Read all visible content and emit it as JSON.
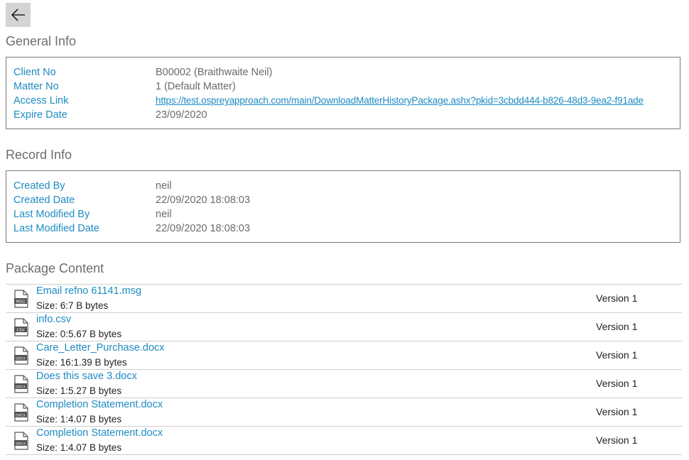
{
  "general_info": {
    "title": "General Info",
    "fields": [
      {
        "label": "Client No",
        "value": "B00002 (Braithwaite Neil)"
      },
      {
        "label": "Matter No",
        "value": "1 (Default Matter)"
      },
      {
        "label": "Access Link",
        "value": "https://test.ospreyapproach.com/main/DownloadMatterHistoryPackage.ashx?pkid=3cbdd444-b826-48d3-9ea2-f91ade"
      },
      {
        "label": "Expire Date",
        "value": "23/09/2020"
      }
    ]
  },
  "record_info": {
    "title": "Record Info",
    "fields": [
      {
        "label": "Created By",
        "value": "neil"
      },
      {
        "label": "Created Date",
        "value": "22/09/2020 18:08:03"
      },
      {
        "label": "Last Modified By",
        "value": "neil"
      },
      {
        "label": "Last Modified Date",
        "value": "22/09/2020 18:08:03"
      }
    ]
  },
  "package_content": {
    "title": "Package Content",
    "items": [
      {
        "name": "Email refno 61141.msg",
        "size": "Size: 6:7 B bytes",
        "version": "Version 1",
        "icon": "msg-file-icon",
        "tag": "MSG"
      },
      {
        "name": "info.csv",
        "size": "Size: 0:5.67 B bytes",
        "version": "Version 1",
        "icon": "csv-file-icon",
        "tag": "CSV"
      },
      {
        "name": "Care_Letter_Purchase.docx",
        "size": "Size: 16:1.39 B bytes",
        "version": "Version 1",
        "icon": "docx-file-icon",
        "tag": "DOCX"
      },
      {
        "name": "Does this save 3.docx",
        "size": "Size: 1:5.27 B bytes",
        "version": "Version 1",
        "icon": "docx-file-icon",
        "tag": "DOCX"
      },
      {
        "name": "Completion Statement.docx",
        "size": "Size: 1:4.07 B bytes",
        "version": "Version 1",
        "icon": "docx-file-icon",
        "tag": "DOCX"
      },
      {
        "name": "Completion Statement.docx",
        "size": "Size: 1:4.07 B bytes",
        "version": "Version 1",
        "icon": "docx-file-icon",
        "tag": "DOCX"
      }
    ]
  },
  "colors": {
    "accent": "#1e8bc3",
    "back_button_bg": "#d4d4d4"
  },
  "icons": {
    "back": "arrow-left-icon"
  }
}
